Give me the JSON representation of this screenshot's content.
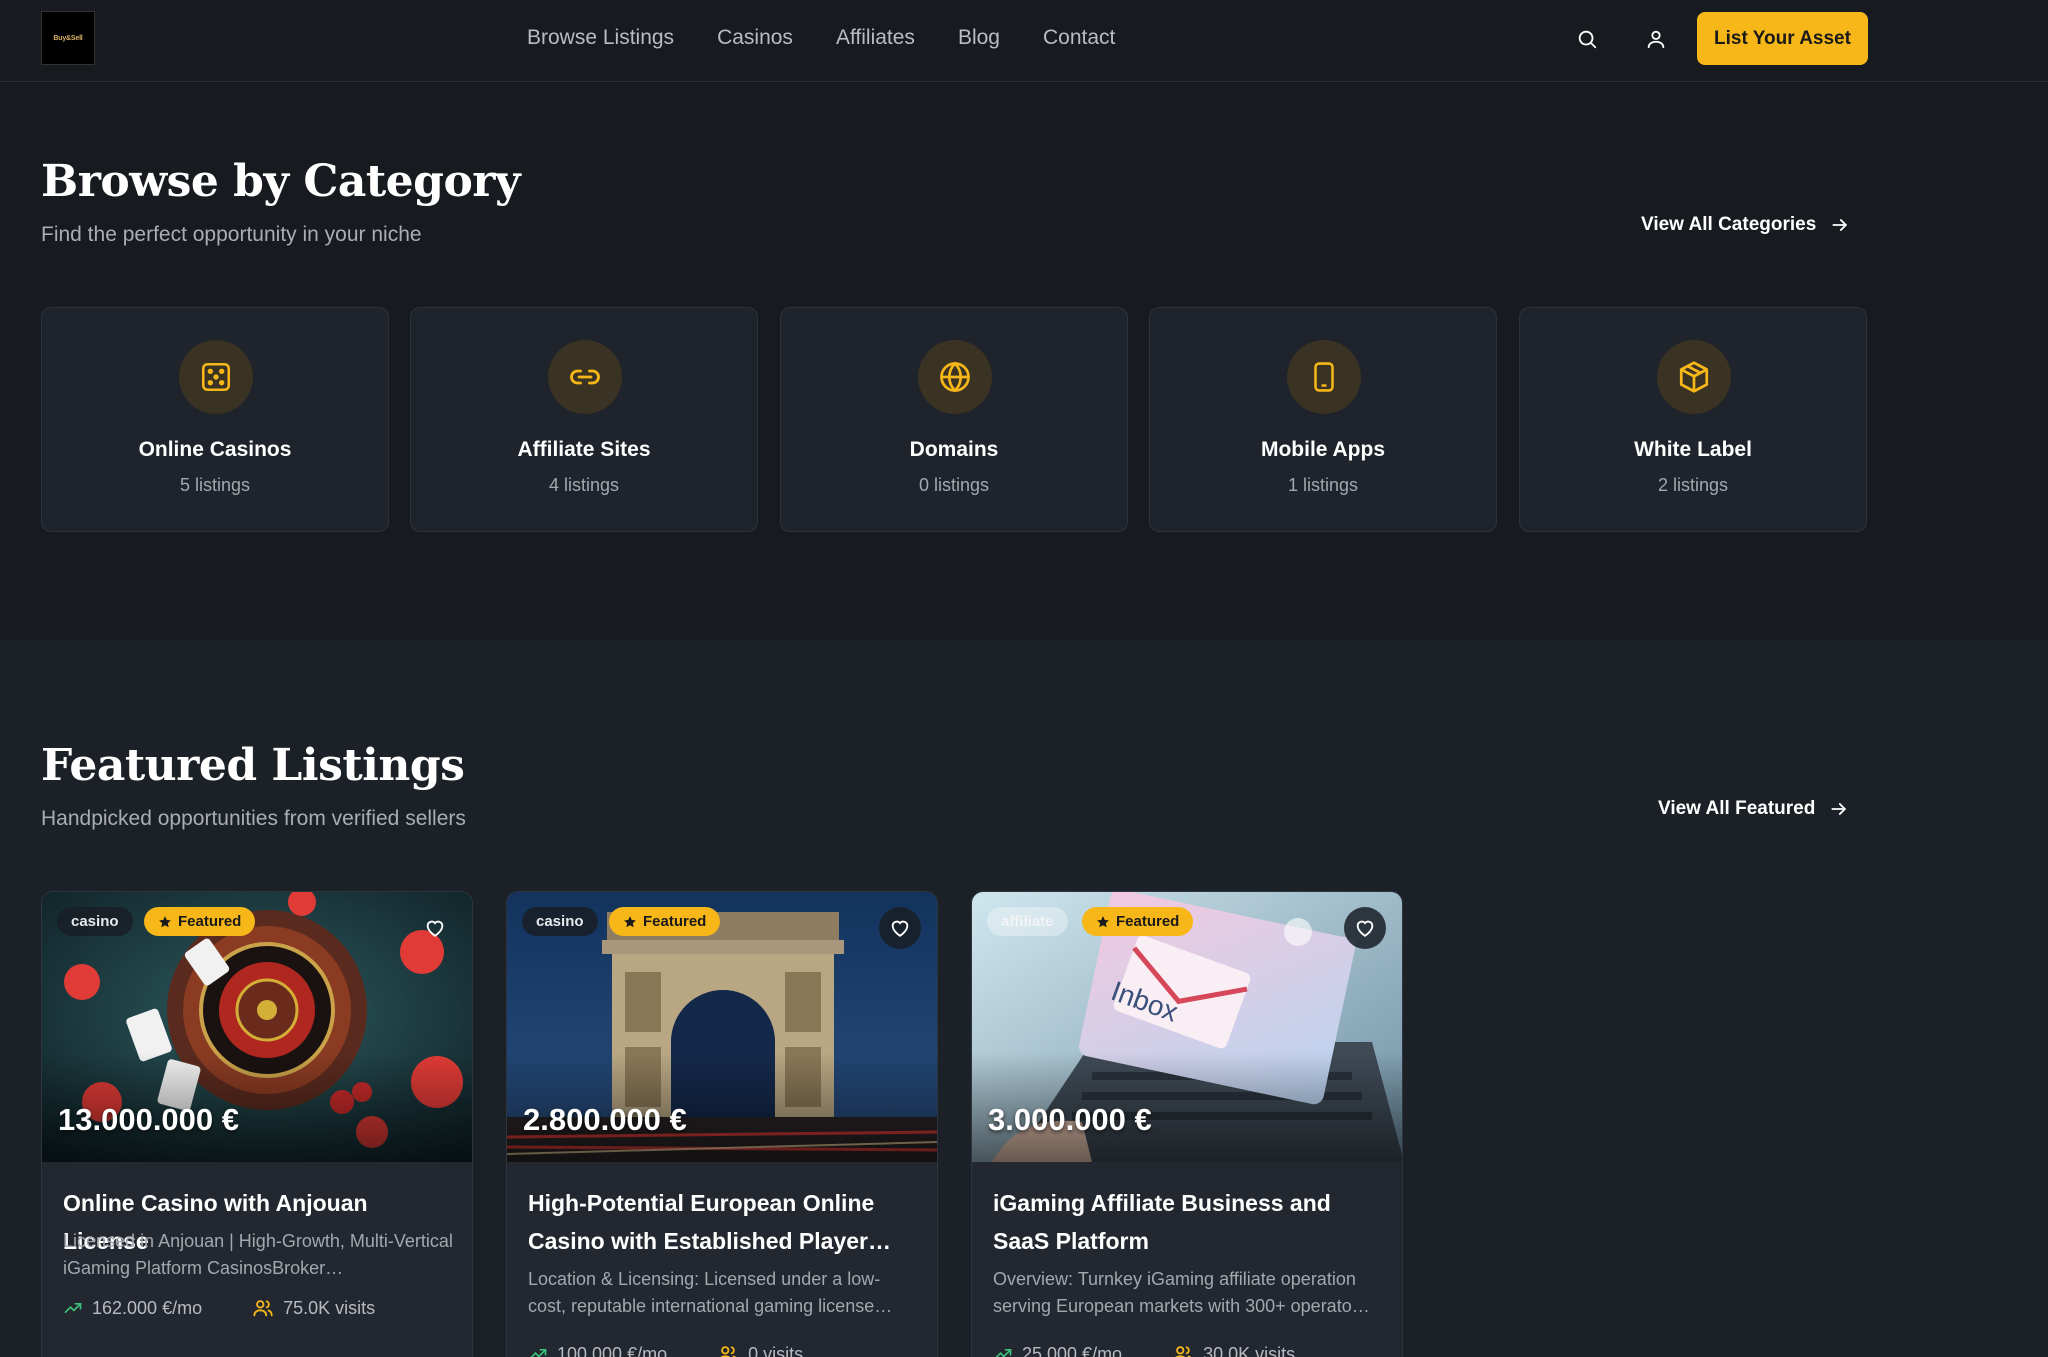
{
  "header": {
    "logo_text": "Buy&Sell",
    "nav": [
      "Browse Listings",
      "Casinos",
      "Affiliates",
      "Blog",
      "Contact"
    ],
    "cta": "List Your Asset",
    "icons": [
      "search-icon",
      "user-icon"
    ]
  },
  "categories_section": {
    "title": "Browse by Category",
    "subtitle": "Find the perfect opportunity in your niche",
    "view_all": "View All Categories",
    "items": [
      {
        "name": "Online Casinos",
        "count": "5 listings",
        "icon": "dice-icon"
      },
      {
        "name": "Affiliate Sites",
        "count": "4 listings",
        "icon": "link-icon"
      },
      {
        "name": "Domains",
        "count": "0 listings",
        "icon": "globe-icon"
      },
      {
        "name": "Mobile Apps",
        "count": "1 listings",
        "icon": "smartphone-icon"
      },
      {
        "name": "White Label",
        "count": "2 listings",
        "icon": "package-icon"
      }
    ]
  },
  "featured_section": {
    "title": "Featured Listings",
    "subtitle": "Handpicked opportunities from verified sellers",
    "view_all": "View All Featured",
    "featured_label": "Featured",
    "listings": [
      {
        "type": "casino",
        "price": "13.000.000 €",
        "title": "Online Casino with Anjouan License",
        "description": "Licensed in Anjouan | High-Growth, Multi-Vertical iGaming Platform CasinosBroker…",
        "revenue": "162.000 €/mo",
        "visits": "75.0K visits"
      },
      {
        "type": "casino",
        "price": "2.800.000 €",
        "title": "High-Potential European Online Casino with Established Player…",
        "description": "Location & Licensing: Licensed under a low-cost, reputable international gaming license…",
        "revenue": "100.000 €/mo",
        "visits": "0 visits"
      },
      {
        "type": "affiliate",
        "price": "3.000.000 €",
        "title": "iGaming Affiliate Business and SaaS Platform",
        "description": "Overview: Turnkey iGaming affiliate operation serving European markets with 300+ operato…",
        "revenue": "25.000 €/mo",
        "visits": "30.0K visits",
        "image_text": "Inbox"
      }
    ]
  },
  "colors": {
    "accent": "#f7b718",
    "background": "#171a1f",
    "card": "#1f242c"
  }
}
